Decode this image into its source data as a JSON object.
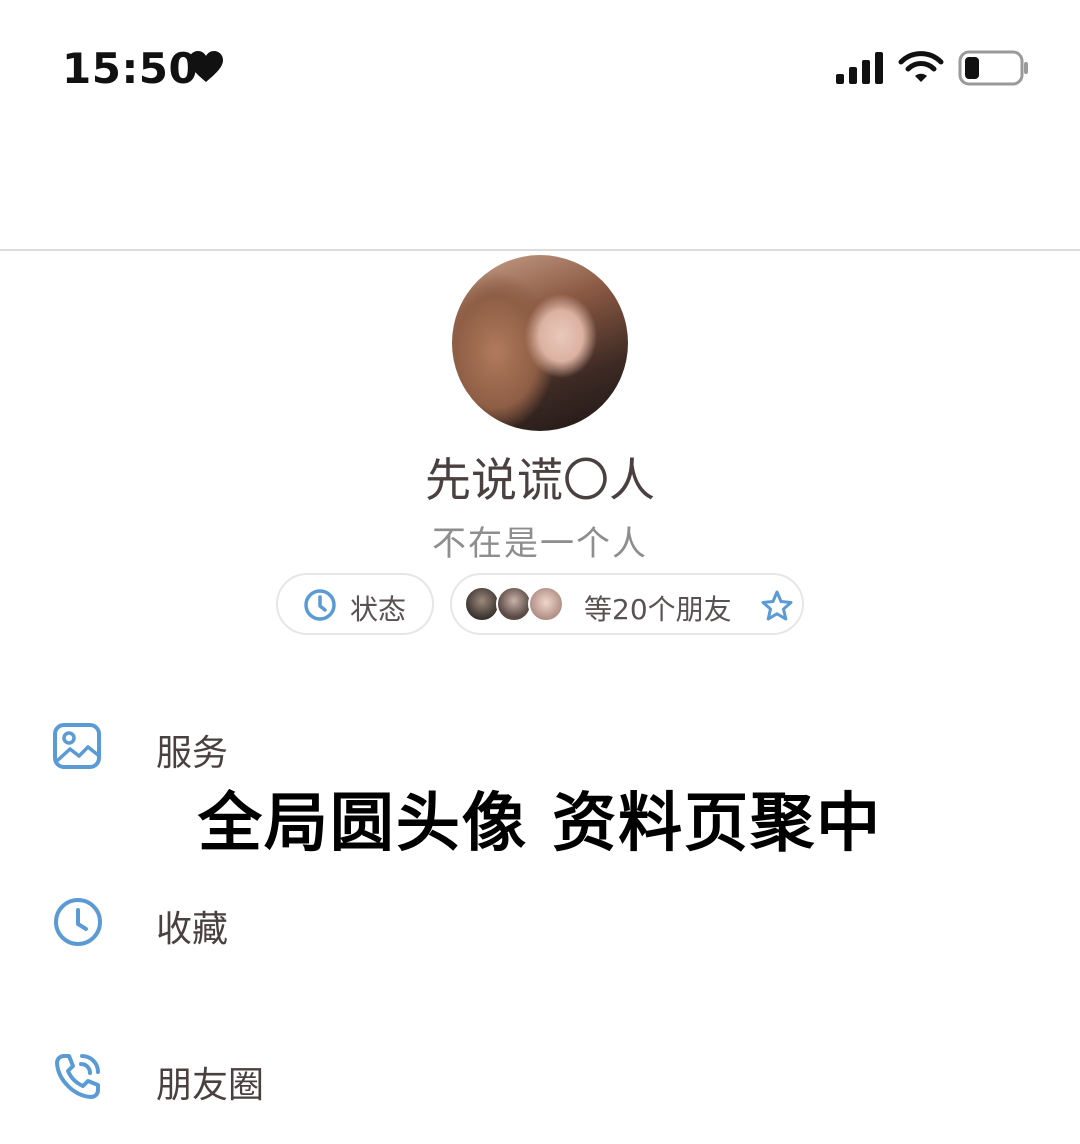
{
  "status_bar": {
    "time": "15:50",
    "icons": [
      "heart-icon",
      "signal-icon",
      "wifi-icon",
      "battery-icon"
    ]
  },
  "profile": {
    "name": "先说谎〇人",
    "signature": "不在是一个人",
    "status_chip": {
      "label": "状态",
      "icon": "clock-icon"
    },
    "friends_chip": {
      "label": "等20个朋友",
      "icon": "star-outline-icon",
      "avatar_count": 3
    }
  },
  "menu": [
    {
      "label": "服务",
      "icon": "image-icon"
    },
    {
      "label": "收藏",
      "icon": "clock-icon"
    },
    {
      "label": "朋友圈",
      "icon": "phone-call-icon"
    }
  ],
  "overlay_caption": "全局圆头像 资料页聚中",
  "colors": {
    "icon_blue": "#5b9bd5",
    "text_dark": "#4a4040",
    "text_muted": "#8e8e8e"
  }
}
